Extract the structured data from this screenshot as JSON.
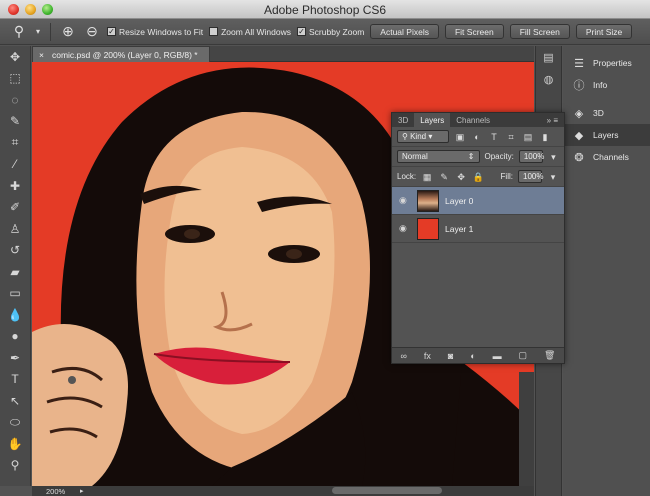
{
  "window": {
    "title": "Adobe Photoshop CS6"
  },
  "options_bar": {
    "resize_windows": {
      "label": "Resize Windows to Fit",
      "checked": true
    },
    "zoom_all_windows": {
      "label": "Zoom All Windows",
      "checked": false
    },
    "scrubby_zoom": {
      "label": "Scrubby Zoom",
      "checked": true
    },
    "buttons": [
      "Actual Pixels",
      "Fit Screen",
      "Fill Screen",
      "Print Size"
    ]
  },
  "document": {
    "tab_title": "comic.psd @ 200% (Layer 0, RGB/8) *",
    "close": "×"
  },
  "status": {
    "zoom": "200%"
  },
  "right_panels": {
    "group1": [
      {
        "label": "Properties",
        "icon": "sliders-icon"
      },
      {
        "label": "Info",
        "icon": "info-icon"
      }
    ],
    "group2": [
      {
        "label": "3D",
        "icon": "cube-icon"
      },
      {
        "label": "Layers",
        "icon": "layers-icon"
      },
      {
        "label": "Channels",
        "icon": "channels-icon"
      }
    ]
  },
  "layers_panel": {
    "tabs": [
      "3D",
      "Layers",
      "Channels"
    ],
    "active_tab": "Layers",
    "filter": "Kind",
    "blend_mode": "Normal",
    "opacity_label": "Opacity:",
    "opacity": "100%",
    "lock_label": "Lock:",
    "fill_label": "Fill:",
    "fill": "100%",
    "layers": [
      {
        "name": "Layer 0",
        "selected": true,
        "thumb": "photo"
      },
      {
        "name": "Layer 1",
        "selected": false,
        "thumb": "red"
      }
    ]
  },
  "colors": {
    "canvas_bg": "#e43b26",
    "selection": "#6e7d95"
  }
}
